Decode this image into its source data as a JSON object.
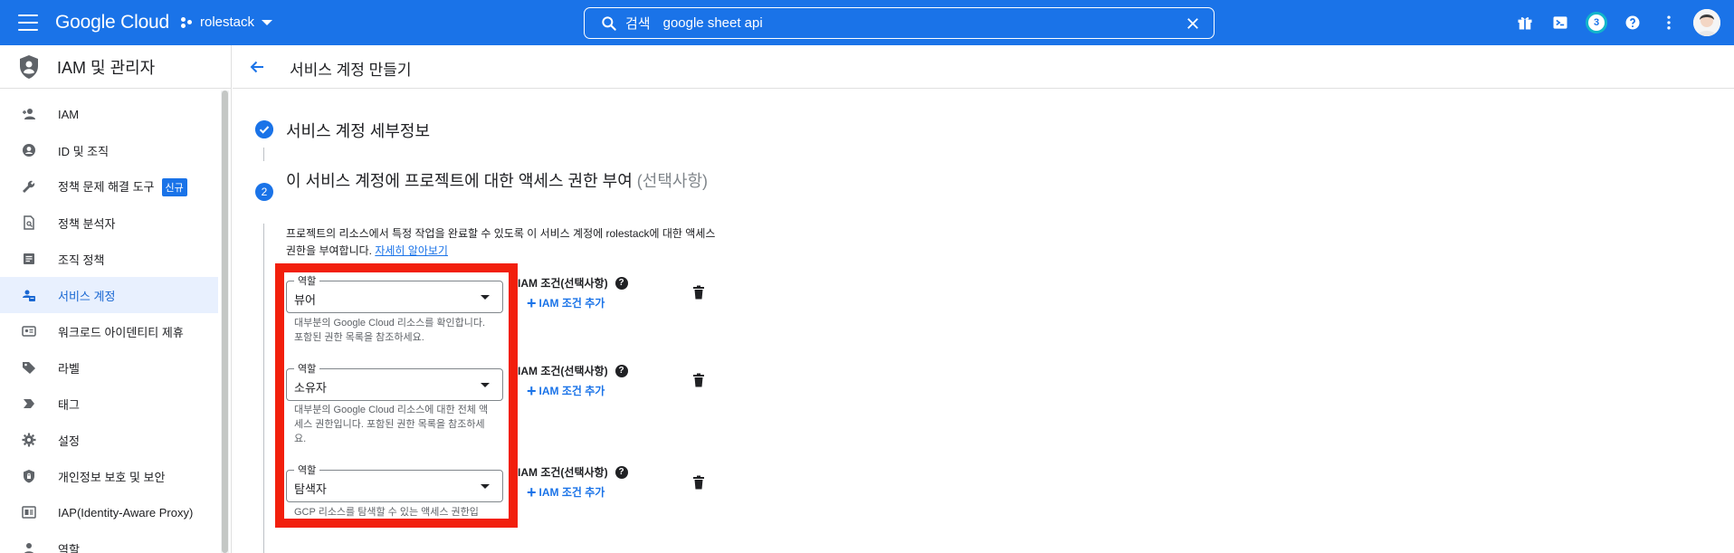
{
  "topbar": {
    "logo": "Google Cloud",
    "project": "rolestack",
    "search_label": "검색",
    "search_value": "google sheet api",
    "notification_count": "3"
  },
  "sidebar": {
    "title": "IAM 및 관리자",
    "new_badge": "신규",
    "items": [
      {
        "label": "IAM",
        "icon": "person-add-icon"
      },
      {
        "label": "ID 및 조직",
        "icon": "account-circle-icon"
      },
      {
        "label": "정책 문제 해결 도구",
        "icon": "wrench-icon"
      },
      {
        "label": "정책 분석자",
        "icon": "document-search-icon"
      },
      {
        "label": "조직 정책",
        "icon": "article-icon"
      },
      {
        "label": "서비스 계정",
        "icon": "service-account-icon"
      },
      {
        "label": "워크로드 아이덴티티 제휴",
        "icon": "badge-icon"
      },
      {
        "label": "라벨",
        "icon": "label-icon"
      },
      {
        "label": "태그",
        "icon": "tag-icon"
      },
      {
        "label": "설정",
        "icon": "gear-icon"
      },
      {
        "label": "개인정보 보호 및 보안",
        "icon": "shield-lock-icon"
      },
      {
        "label": "IAP(Identity-Aware Proxy)",
        "icon": "proxy-icon"
      },
      {
        "label": "역할",
        "icon": "roles-icon"
      }
    ]
  },
  "page": {
    "title": "서비스 계정 만들기",
    "step1_title": "서비스 계정 세부정보",
    "step2_number": "2",
    "step2_title": "이 서비스 계정에 프로젝트에 대한 액세스 권한 부여",
    "step2_optional": "(선택사항)",
    "description": "프로젝트의 리소스에서 특정 작업을 완료할 수 있도록 이 서비스 계정에 rolestack에 대한 액세스 권한을 부여합니다.",
    "learn_more": "자세히 알아보기"
  },
  "roles": [
    {
      "legend": "역할",
      "value": "뷰어",
      "hint": "대부분의 Google Cloud 리소스를 확인합니다. 포함된 권한 목록을 참조하세요."
    },
    {
      "legend": "역할",
      "value": "소유자",
      "hint": "대부분의 Google Cloud 리소스에 대한 전체 액세스 권한입니다. 포함된 권한 목록을 참조하세요."
    },
    {
      "legend": "역할",
      "value": "탐색자",
      "hint": "GCP 리소스를 탐색할 수 있는 액세스 권한입"
    }
  ],
  "condition": {
    "label": "IAM 조건(선택사항)",
    "help": "?",
    "add_label": "IAM 조건 추가"
  },
  "colors": {
    "brand_blue": "#1a73e8",
    "highlight_red": "#f21f0c"
  }
}
